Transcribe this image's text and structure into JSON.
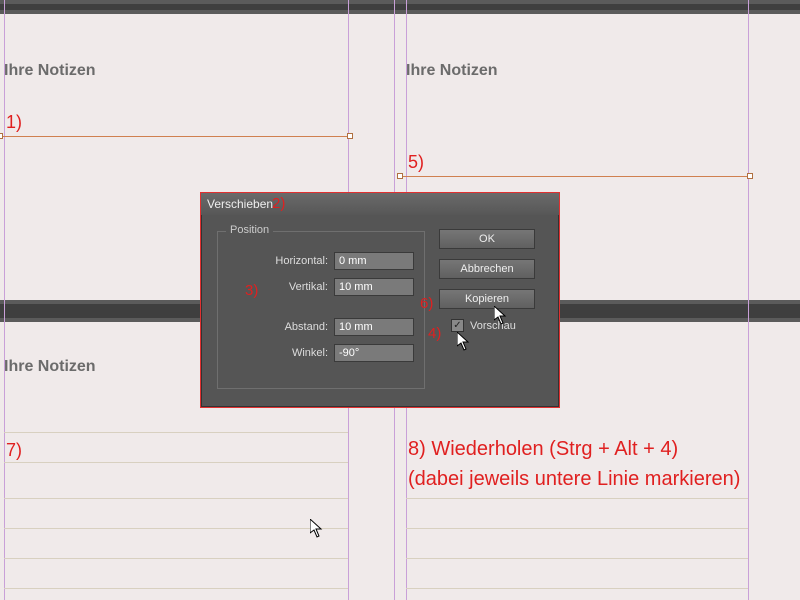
{
  "notes_heading": "Ihre Notizen",
  "annotations": {
    "a1": "1)",
    "a2": "2)",
    "a3": "3)",
    "a4": "4)",
    "a5": "5)",
    "a6": "6)",
    "a7": "7)",
    "a8_line1": "8) Wiederholen (Strg + Alt + 4)",
    "a8_line2": "(dabei jeweils untere Linie markieren)"
  },
  "dialog": {
    "title": "Verschieben",
    "position_group": "Position",
    "labels": {
      "horizontal": "Horizontal:",
      "vertical": "Vertikal:",
      "distance": "Abstand:",
      "angle": "Winkel:"
    },
    "values": {
      "horizontal": "0 mm",
      "vertical": "10 mm",
      "distance": "10 mm",
      "angle": "-90°"
    },
    "buttons": {
      "ok": "OK",
      "cancel": "Abbrechen",
      "copy": "Kopieren"
    },
    "preview_label": "Vorschau",
    "preview_checked": true
  }
}
